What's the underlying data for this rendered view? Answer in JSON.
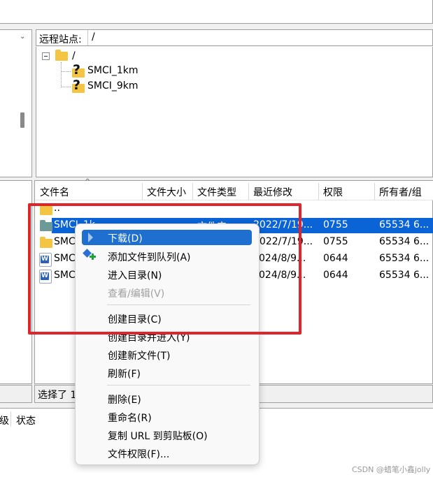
{
  "remote": {
    "label": "远程站点:",
    "path": "/",
    "tree": [
      {
        "name": "/"
      },
      {
        "name": "SMCI_1km"
      },
      {
        "name": "SMCI_9km"
      }
    ]
  },
  "file_list": {
    "columns": [
      "文件名",
      "文件大小",
      "文件类型",
      "最近修改",
      "权限",
      "所有者/组"
    ],
    "rows": [
      {
        "name": "..",
        "size": "",
        "type": "",
        "modified": "",
        "perms": "",
        "owner": ""
      },
      {
        "name": "SMCI_1k",
        "size": "",
        "type": "文件夹",
        "modified": "2022/7/19...",
        "perms": "0755",
        "owner": "65534 6...",
        "selected": true
      },
      {
        "name": "SMC",
        "size": "",
        "type": "",
        "modified": "2022/7/19...",
        "perms": "0755",
        "owner": "65534 6..."
      },
      {
        "name": "SMC",
        "size": "",
        "type": "",
        "modified": "024/8/9...",
        "perms": "0644",
        "owner": "65534 6..."
      },
      {
        "name": "SMC",
        "size": "",
        "type": "",
        "modified": "024/8/9...",
        "perms": "0644",
        "owner": "65534 6..."
      }
    ],
    "status_text": "选择了 1"
  },
  "queue": {
    "col_left": "级",
    "col_status": "状态"
  },
  "context_menu": {
    "items": [
      {
        "label": "下载(D)",
        "highlighted": true
      },
      {
        "label": "添加文件到队列(A)"
      },
      {
        "label": "进入目录(N)"
      },
      {
        "label": "查看/编辑(V)",
        "disabled": true
      },
      {
        "label": "创建目录(C)"
      },
      {
        "label": "创建目录并进入(Y)"
      },
      {
        "label": "创建新文件(T)"
      },
      {
        "label": "刷新(F)"
      },
      {
        "label": "删除(E)"
      },
      {
        "label": "重命名(R)"
      },
      {
        "label": "复制 URL 到剪贴板(O)"
      },
      {
        "label": "文件权限(F)..."
      }
    ]
  },
  "watermark": "CSDN @蜡笔小鑫jolly",
  "colors": {
    "selection": "#0a64d6",
    "menu_highlight": "#1f6fd1",
    "annotation_box": "#e0242c"
  }
}
